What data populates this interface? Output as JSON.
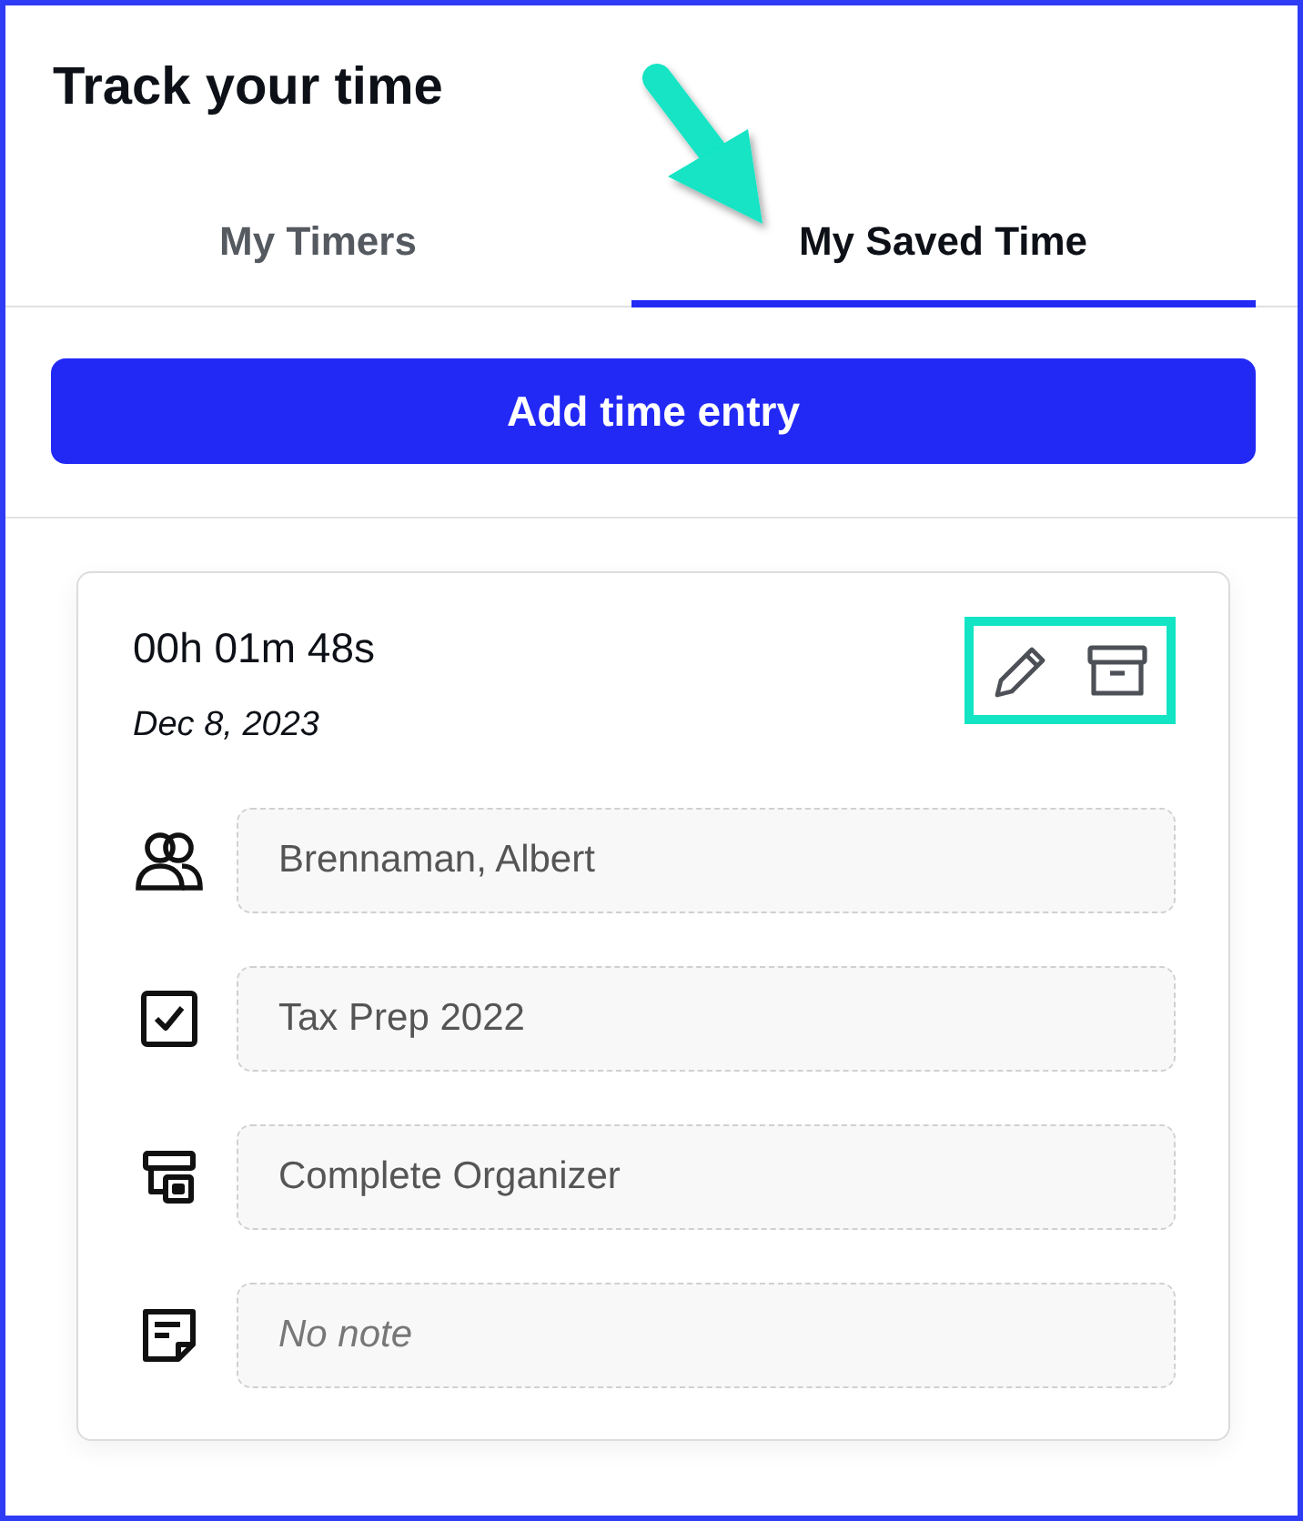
{
  "title": "Track your time",
  "tabs": [
    {
      "label": "My Timers",
      "selected": false
    },
    {
      "label": "My Saved Time",
      "selected": true
    }
  ],
  "add_button": "Add time entry",
  "entry": {
    "duration": "00h 01m 48s",
    "date": "Dec 8, 2023",
    "highlighted_actions": true,
    "fields": [
      {
        "kind": "client",
        "value": "Brennaman, Albert"
      },
      {
        "kind": "project",
        "value": "Tax Prep 2022"
      },
      {
        "kind": "task",
        "value": "Complete Organizer"
      },
      {
        "kind": "note",
        "placeholder": "No note"
      }
    ]
  }
}
